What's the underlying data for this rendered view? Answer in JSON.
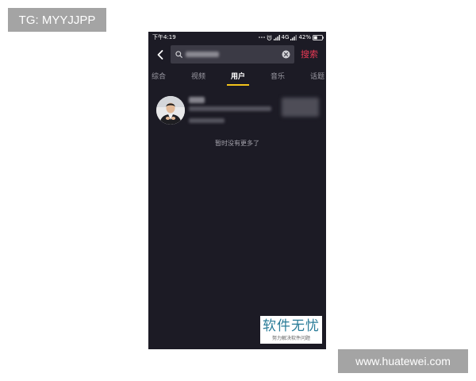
{
  "watermarks": {
    "tg": "TG: MYYJJPP",
    "site": "www.huatewei.com",
    "logo_title": "软件无忧",
    "logo_subtitle": "努力解决软件问题"
  },
  "status_bar": {
    "time": "下午4:19",
    "network": "4G",
    "battery": "42%",
    "battery_level": 0.42
  },
  "search": {
    "button_label": "搜索"
  },
  "tabs": [
    {
      "label": "综合",
      "active": false
    },
    {
      "label": "视频",
      "active": false
    },
    {
      "label": "用户",
      "active": true
    },
    {
      "label": "音乐",
      "active": false
    },
    {
      "label": "话题",
      "active": false
    }
  ],
  "results": {
    "end_message": "暂时没有更多了"
  },
  "icons": {
    "back": "chevron-left-icon",
    "search": "search-icon",
    "clear": "clear-search-icon",
    "notifications": "more-dots-icon",
    "alarm": "alarm-icon",
    "signal": "signal-icon",
    "battery": "battery-icon"
  },
  "colors": {
    "background": "#1c1b25",
    "accent": "#ea3a55",
    "tab_indicator": "#f2c31b",
    "logo": "#2a7c98"
  }
}
